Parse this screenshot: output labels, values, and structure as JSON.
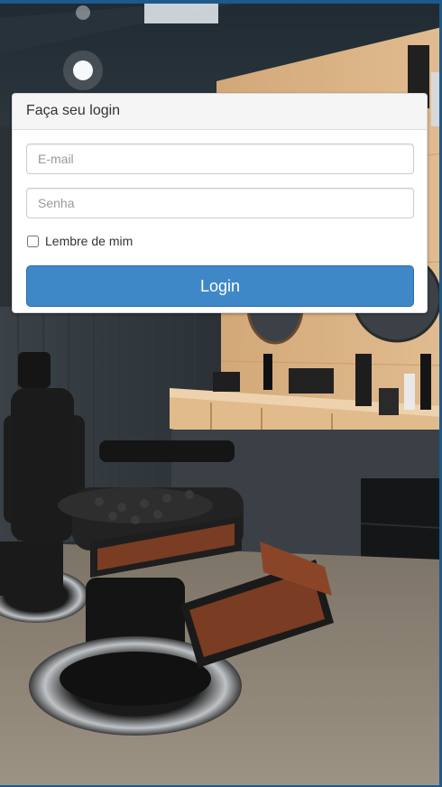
{
  "login": {
    "title": "Faça seu login",
    "email_placeholder": "E-mail",
    "password_placeholder": "Senha",
    "remember_label": "Lembre de mim",
    "submit_label": "Login"
  },
  "colors": {
    "primary_button": "#3f88c8",
    "frame_accent": "#1c5a8e"
  }
}
